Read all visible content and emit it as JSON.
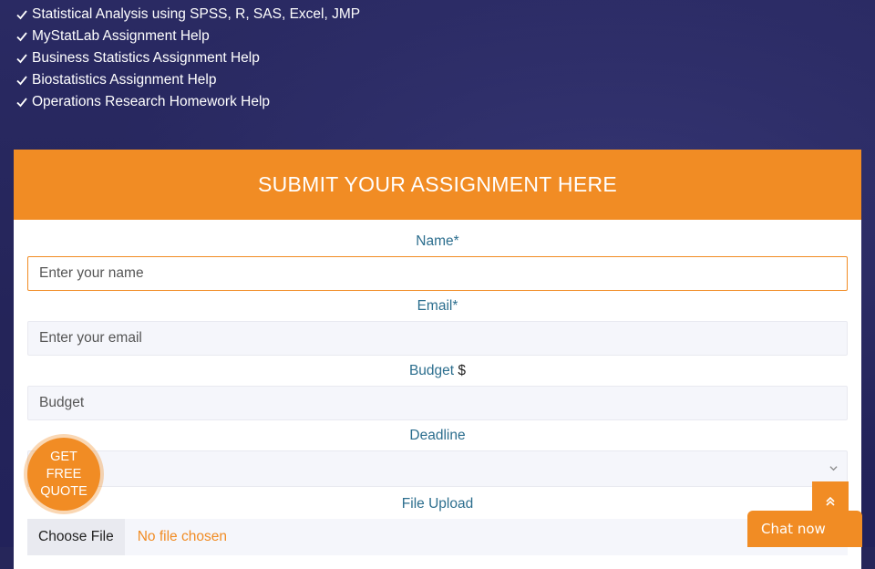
{
  "services": [
    "Statistical Analysis using SPSS, R, SAS, Excel, JMP",
    "MyStatLab Assignment Help",
    "Business Statistics Assignment Help",
    "Biostatistics Assignment Help",
    "Operations Research Homework Help"
  ],
  "form": {
    "title": "SUBMIT YOUR ASSIGNMENT  HERE",
    "name_label": "Name*",
    "name_placeholder": "Enter your name",
    "email_label": "Email*",
    "email_placeholder": "Enter your email",
    "budget_label": "Budget",
    "budget_symbol": "$",
    "budget_placeholder": "Budget",
    "deadline_label": "Deadline",
    "deadline_value": "",
    "upload_label": "File Upload",
    "choose_file": "Choose File",
    "no_file": "No file chosen"
  },
  "quote_button": "GET FREE QUOTE",
  "chat_label": "Chat now",
  "colors": {
    "accent": "#f18c24",
    "label": "#2c6e8e",
    "background": "#26265a"
  },
  "icons": [
    "check-icon",
    "chevron-down-icon",
    "double-chevron-up-icon"
  ]
}
